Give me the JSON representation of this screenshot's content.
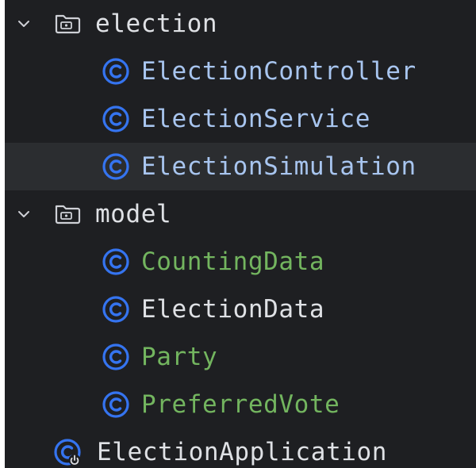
{
  "project_tree": {
    "election_folder": {
      "label": "election",
      "expanded": true,
      "icon": "folder-icon"
    },
    "election_classes": [
      {
        "label": "ElectionController",
        "icon": "class-icon",
        "color": "#a8c5ef"
      },
      {
        "label": "ElectionService",
        "icon": "class-icon",
        "color": "#a8c5ef"
      },
      {
        "label": "ElectionSimulation",
        "icon": "class-icon",
        "color": "#a8c5ef",
        "selected": true
      }
    ],
    "model_folder": {
      "label": "model",
      "expanded": true,
      "icon": "folder-icon"
    },
    "model_classes": [
      {
        "label": "CountingData",
        "icon": "class-icon",
        "color": "#73b55f"
      },
      {
        "label": "ElectionData",
        "icon": "class-icon",
        "color": "#dfe1e5"
      },
      {
        "label": "Party",
        "icon": "class-icon",
        "color": "#73b55f"
      },
      {
        "label": "PreferredVote",
        "icon": "class-icon",
        "color": "#73b55f"
      }
    ],
    "application_class": {
      "label": "ElectionApplication",
      "icon": "spring-boot-class-icon"
    }
  },
  "colors": {
    "background": "#1e1f22",
    "selected_row": "#2b2d30",
    "class_icon": "#3574f0",
    "folder_icon": "#ced0d6",
    "modified_file": "#a8c5ef",
    "new_file": "#73b55f",
    "default_text": "#dfe1e5"
  }
}
